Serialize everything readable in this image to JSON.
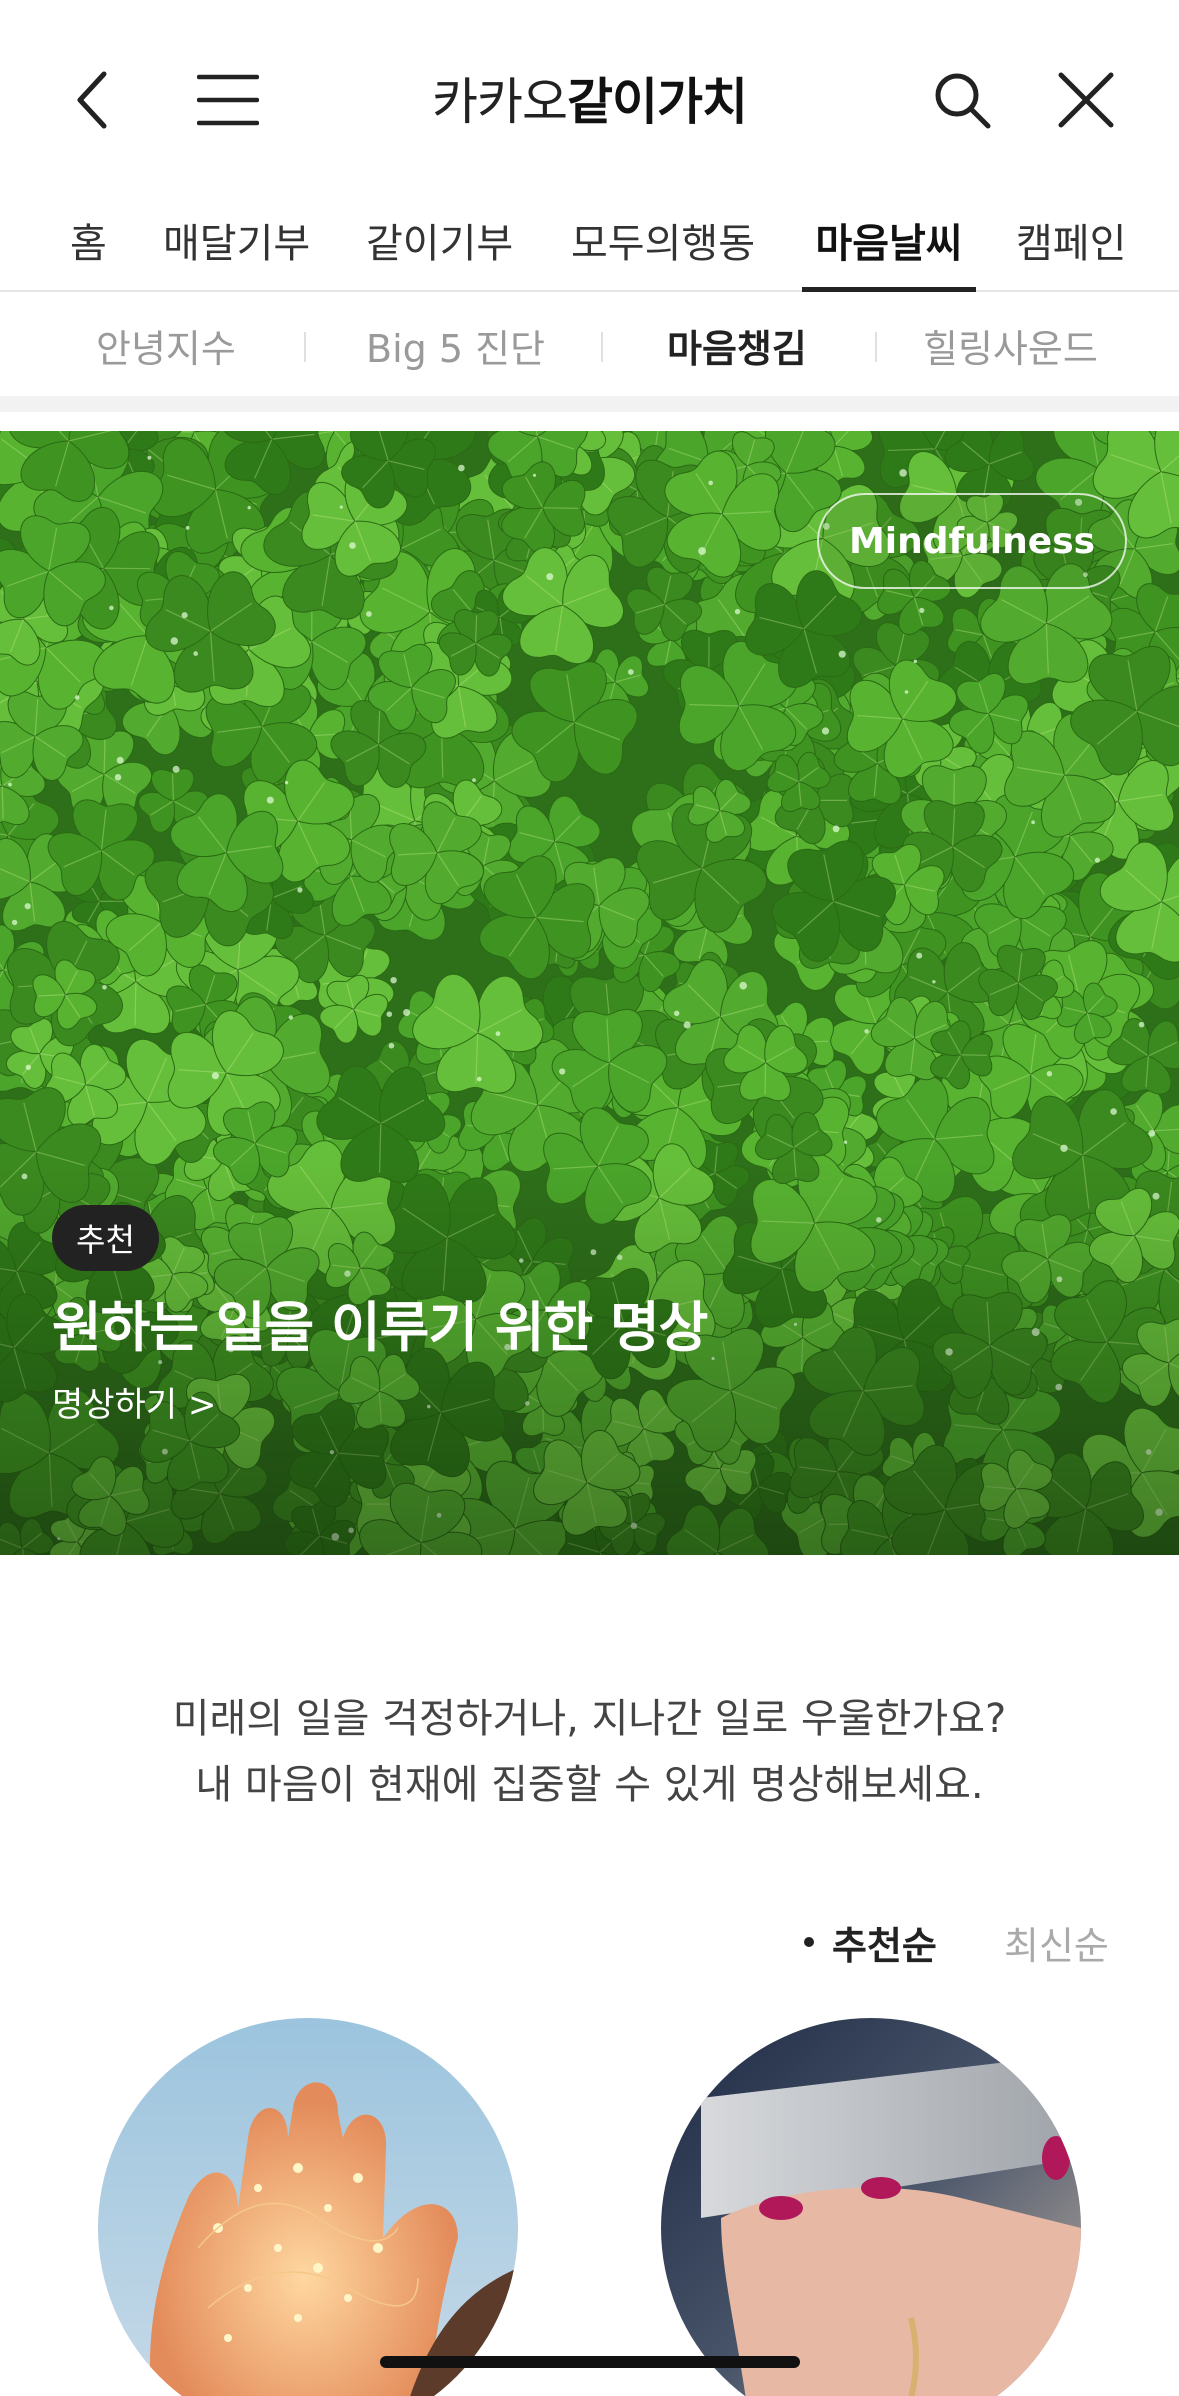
{
  "header": {
    "brand_light": "카카오",
    "brand_bold": "같이가치",
    "back_icon": "chevron-left-icon",
    "menu_icon": "hamburger-menu-icon",
    "search_icon": "search-icon",
    "close_icon": "close-icon"
  },
  "main_tabs": [
    {
      "label": "홈",
      "active": false
    },
    {
      "label": "매달기부",
      "active": false
    },
    {
      "label": "같이기부",
      "active": false
    },
    {
      "label": "모두의행동",
      "active": false
    },
    {
      "label": "마음날씨",
      "active": true
    },
    {
      "label": "캠페인",
      "active": false
    }
  ],
  "sub_tabs": [
    {
      "label": "안녕지수",
      "active": false
    },
    {
      "label": "Big 5 진단",
      "active": false
    },
    {
      "label": "마음챙김",
      "active": true
    },
    {
      "label": "힐링사운드",
      "active": false
    }
  ],
  "hero": {
    "tag": "Mindfulness",
    "badge": "추천",
    "title": "원하는 일을 이루기 위한 명상",
    "link": "명상하기 >"
  },
  "description": {
    "line1": "미래의 일을 걱정하거나, 지나간 일로 우울한가요?",
    "line2": "내 마음이 현재에 집중할 수 있게 명상해보세요."
  },
  "sort": {
    "active_label": "추천순",
    "inactive_label": "최신순"
  },
  "colors": {
    "accent_dark": "#222222",
    "hero_green": "#2f7a1c"
  }
}
